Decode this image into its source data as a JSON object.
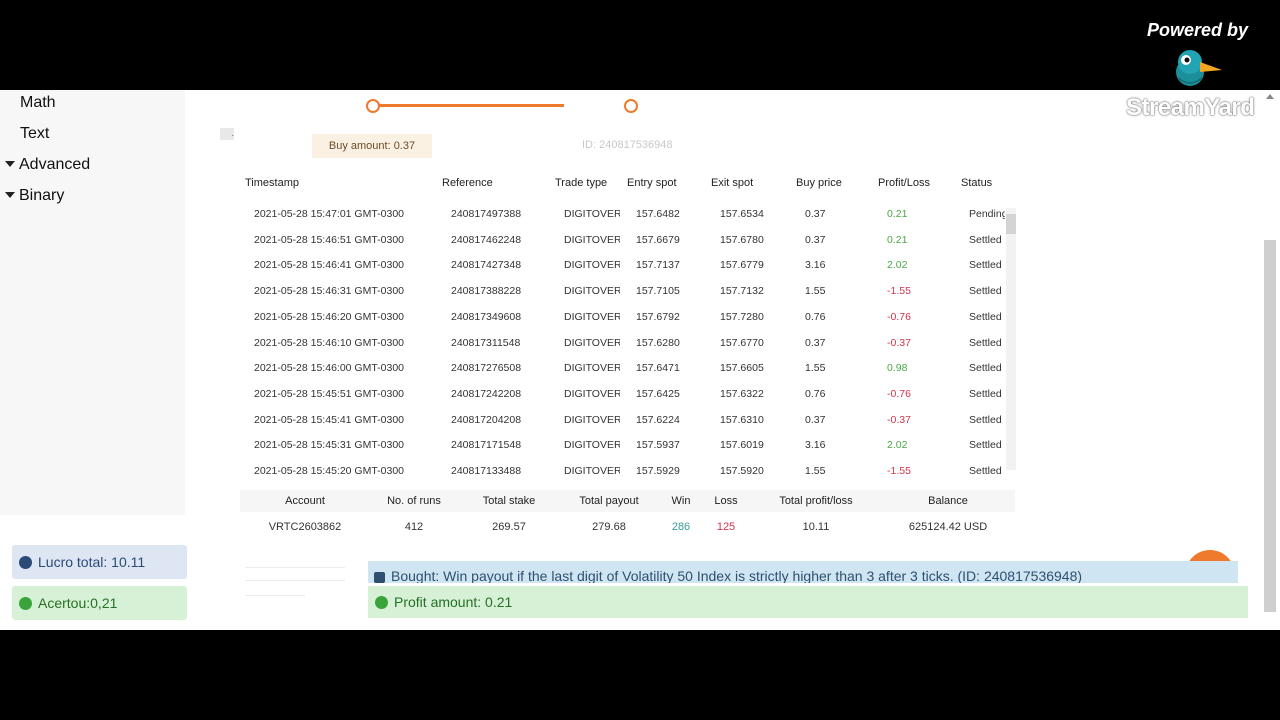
{
  "overlay": {
    "powered_by": "Powered by",
    "streamyard_label": "StreamYard"
  },
  "toolbox_tree": {
    "items": [
      {
        "label": "Math",
        "expanded": null
      },
      {
        "label": "Text",
        "expanded": null
      },
      {
        "label": "Advanced",
        "expanded": true
      },
      {
        "label": "Binary",
        "expanded": true
      }
    ]
  },
  "settings": {
    "buy_amount_label": "Buy amount: 0.37",
    "faded_id_text": "ID: 240817536948"
  },
  "transactions": {
    "headers": [
      "Timestamp",
      "Reference",
      "Trade type",
      "Entry spot",
      "Exit spot",
      "Buy price",
      "Profit/Loss",
      "Status"
    ],
    "rows": [
      {
        "timestamp": "2021-05-28 15:47:01 GMT-0300",
        "reference": "240817497388",
        "trade_type": "DIGITOVER",
        "entry_spot": "157.6482",
        "exit_spot": "157.6534",
        "buy_price": "0.37",
        "profit_loss": "0.21",
        "status": "Pending"
      },
      {
        "timestamp": "2021-05-28 15:46:51 GMT-0300",
        "reference": "240817462248",
        "trade_type": "DIGITOVER",
        "entry_spot": "157.6679",
        "exit_spot": "157.6780",
        "buy_price": "0.37",
        "profit_loss": "0.21",
        "status": "Settled"
      },
      {
        "timestamp": "2021-05-28 15:46:41 GMT-0300",
        "reference": "240817427348",
        "trade_type": "DIGITOVER",
        "entry_spot": "157.7137",
        "exit_spot": "157.6779",
        "buy_price": "3.16",
        "profit_loss": "2.02",
        "status": "Settled"
      },
      {
        "timestamp": "2021-05-28 15:46:31 GMT-0300",
        "reference": "240817388228",
        "trade_type": "DIGITOVER",
        "entry_spot": "157.7105",
        "exit_spot": "157.7132",
        "buy_price": "1.55",
        "profit_loss": "-1.55",
        "status": "Settled"
      },
      {
        "timestamp": "2021-05-28 15:46:20 GMT-0300",
        "reference": "240817349608",
        "trade_type": "DIGITOVER",
        "entry_spot": "157.6792",
        "exit_spot": "157.7280",
        "buy_price": "0.76",
        "profit_loss": "-0.76",
        "status": "Settled"
      },
      {
        "timestamp": "2021-05-28 15:46:10 GMT-0300",
        "reference": "240817311548",
        "trade_type": "DIGITOVER",
        "entry_spot": "157.6280",
        "exit_spot": "157.6770",
        "buy_price": "0.37",
        "profit_loss": "-0.37",
        "status": "Settled"
      },
      {
        "timestamp": "2021-05-28 15:46:00 GMT-0300",
        "reference": "240817276508",
        "trade_type": "DIGITOVER",
        "entry_spot": "157.6471",
        "exit_spot": "157.6605",
        "buy_price": "1.55",
        "profit_loss": "0.98",
        "status": "Settled"
      },
      {
        "timestamp": "2021-05-28 15:45:51 GMT-0300",
        "reference": "240817242208",
        "trade_type": "DIGITOVER",
        "entry_spot": "157.6425",
        "exit_spot": "157.6322",
        "buy_price": "0.76",
        "profit_loss": "-0.76",
        "status": "Settled"
      },
      {
        "timestamp": "2021-05-28 15:45:41 GMT-0300",
        "reference": "240817204208",
        "trade_type": "DIGITOVER",
        "entry_spot": "157.6224",
        "exit_spot": "157.6310",
        "buy_price": "0.37",
        "profit_loss": "-0.37",
        "status": "Settled"
      },
      {
        "timestamp": "2021-05-28 15:45:31 GMT-0300",
        "reference": "240817171548",
        "trade_type": "DIGITOVER",
        "entry_spot": "157.5937",
        "exit_spot": "157.6019",
        "buy_price": "3.16",
        "profit_loss": "2.02",
        "status": "Settled"
      },
      {
        "timestamp": "2021-05-28 15:45:20 GMT-0300",
        "reference": "240817133488",
        "trade_type": "DIGITOVER",
        "entry_spot": "157.5929",
        "exit_spot": "157.5920",
        "buy_price": "1.55",
        "profit_loss": "-1.55",
        "status": "Settled"
      }
    ]
  },
  "summary": {
    "headers": [
      "Account",
      "No. of runs",
      "Total stake",
      "Total payout",
      "Win",
      "Loss",
      "Total profit/loss",
      "Balance"
    ],
    "values": [
      "VRTC2603862",
      "412",
      "269.57",
      "279.68",
      "286",
      "125",
      "10.11",
      "625124.42 USD"
    ]
  },
  "notifications": {
    "lucro_total": "Lucro total: 10.11",
    "acertou": "Acertou:0,21",
    "bought": "Bought: Win payout if the last digit of Volatility 50 Index is strictly higher than 3 after 3 ticks. (ID: 240817536948)",
    "profit_amount": "Profit amount: 0.21"
  },
  "colors": {
    "accent_orange": "#f07a2b",
    "profit_green": "#4aa84a",
    "loss_red": "#d2354c",
    "info_blue": "#2b4a78",
    "success_green": "#276f27"
  }
}
